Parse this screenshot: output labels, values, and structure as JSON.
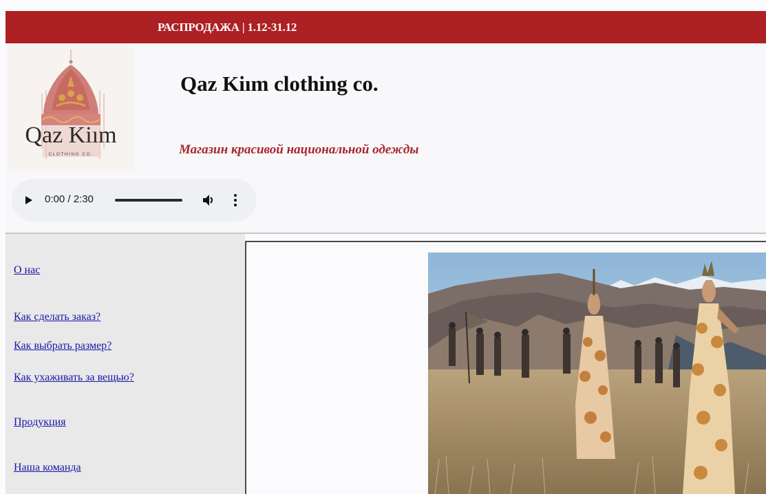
{
  "banner": {
    "text": "РАСПРОДАЖА | 1.12-31.12",
    "color": "#ad2023"
  },
  "header": {
    "title": "Qaz Kiım clothing co.",
    "tagline": "Магазин красивой национальной одежды",
    "tagline_color": "#a8262b"
  },
  "logo": {
    "wordmark": "Qaz Kiım",
    "subtitle": "CLOTHING CO."
  },
  "audio_player": {
    "time_display": "0:00 / 2:30",
    "progress": 0,
    "icons": [
      "play-icon",
      "volume-icon",
      "more-options-icon"
    ]
  },
  "sidebar": {
    "items": [
      {
        "label": "О нас"
      },
      {
        "label": "Как сделать заказ?"
      },
      {
        "label": "Как выбрать размер?"
      },
      {
        "label": "Как ухаживать за вещью?"
      },
      {
        "label": "Продукция"
      },
      {
        "label": "Наша команда"
      }
    ],
    "link_color": "#1a14a8"
  }
}
